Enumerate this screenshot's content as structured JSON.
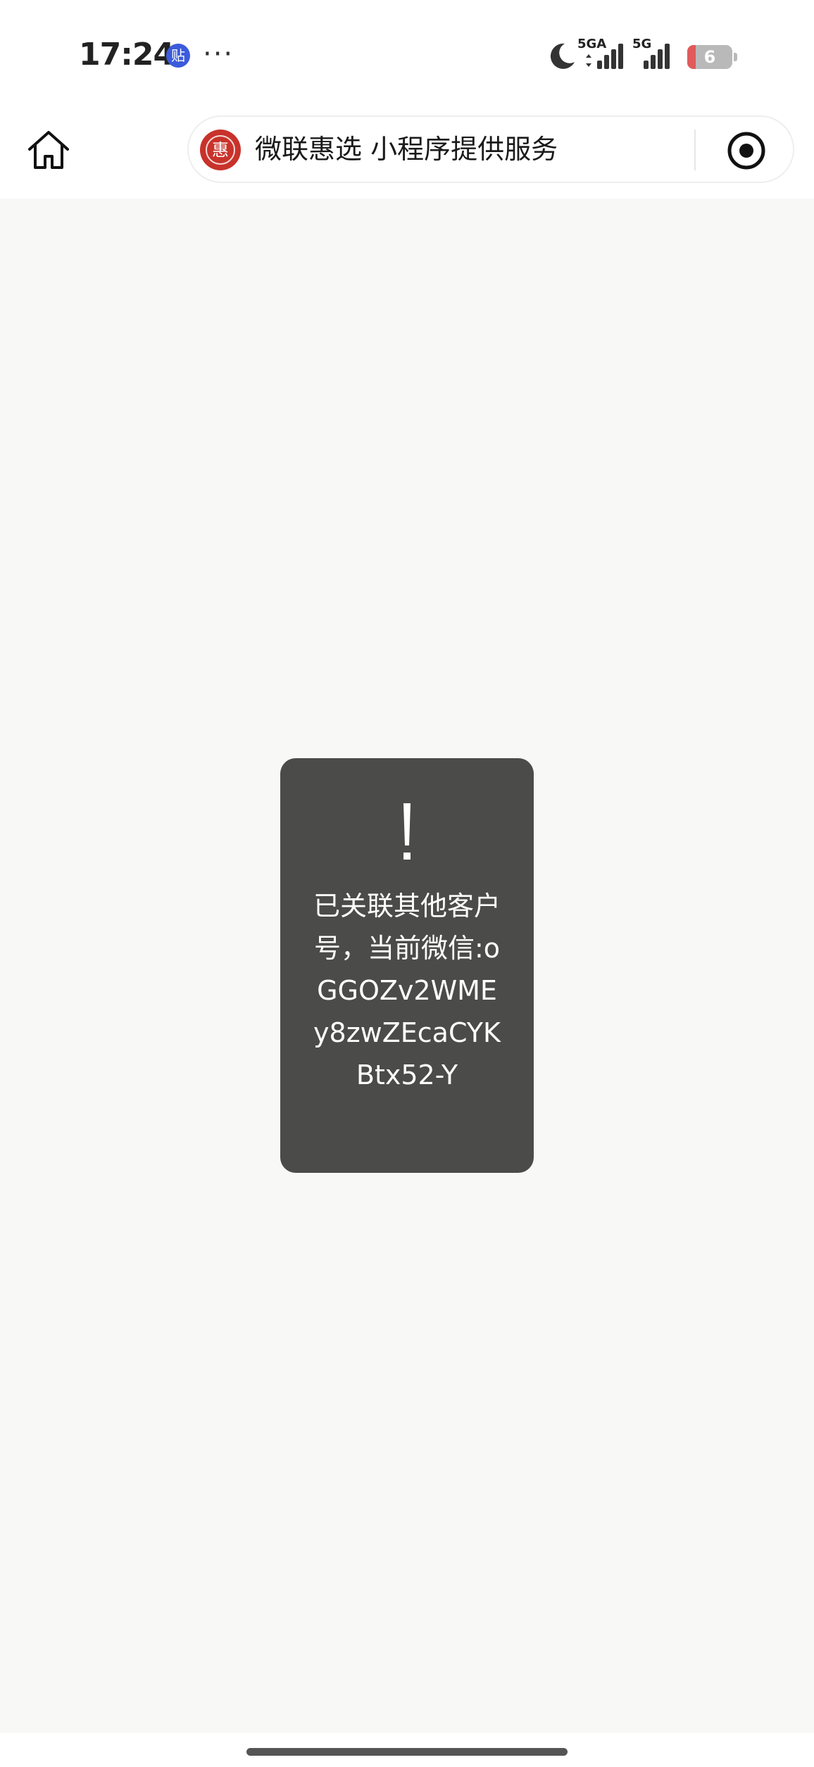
{
  "status_bar": {
    "time": "17:24",
    "app_badge": "贴",
    "more": "···",
    "signal_1_label": "5GA",
    "signal_2_label": "5G",
    "battery_level": "6",
    "battery_percent": 6,
    "icons": [
      "moon-icon",
      "signal-icon",
      "battery-icon"
    ]
  },
  "nav": {
    "mini_logo_glyph": "惠",
    "capsule_title": "微联惠选 小程序提供服务",
    "icons": [
      "home-icon",
      "target-icon"
    ]
  },
  "toast": {
    "icon": "!",
    "message": "已关联其他客户号，当前微信:oGGOZv2WMEy8zwZEcaCYKBtx52-Y"
  },
  "colors": {
    "page_background": "#f8f8f7",
    "toast_background": "#4b4b4a",
    "logo_red": "#c8322b"
  }
}
